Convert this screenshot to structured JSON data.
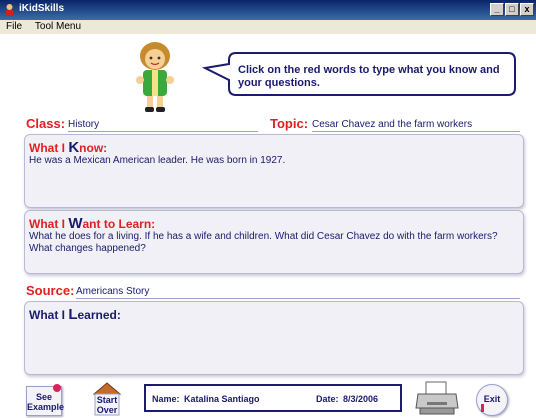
{
  "window": {
    "title": "iKidSkills",
    "min": "_",
    "max": "□",
    "close": "x"
  },
  "menu": {
    "items": [
      "File",
      "Tool Menu"
    ]
  },
  "instruction": "Click on the red words to type what you know and your questions.",
  "class": {
    "label": "Class:",
    "value": "History"
  },
  "topic": {
    "label": "Topic:",
    "value": "Cesar Chavez and the farm workers"
  },
  "know": {
    "head_pre": "What I ",
    "head_big": "K",
    "head_post": "now:",
    "text": "He was a Mexican American leader.  He was born in 1927."
  },
  "want": {
    "head_pre": "What I ",
    "head_big": "W",
    "head_post": "ant to Learn:",
    "text": "What he does for a living.  If he has a wife and children.  What did Cesar Chavez do with the farm workers?  What changes happened?"
  },
  "source": {
    "label": "Source:",
    "value": "Americans Story"
  },
  "learned": {
    "head_pre": "What I ",
    "head_big": "L",
    "head_post": "earned:",
    "text": ""
  },
  "footer": {
    "see_example": [
      "See",
      "Example"
    ],
    "start_over": [
      "Start",
      "Over"
    ],
    "name_label": "Name:",
    "name_value": "Katalina Santiago",
    "date_label": "Date:",
    "date_value": "8/3/2006",
    "exit": "Exit"
  },
  "colors": {
    "accent_red": "#e02020",
    "navy": "#1a1a6e",
    "panel_bg": "#f0f0f6"
  }
}
